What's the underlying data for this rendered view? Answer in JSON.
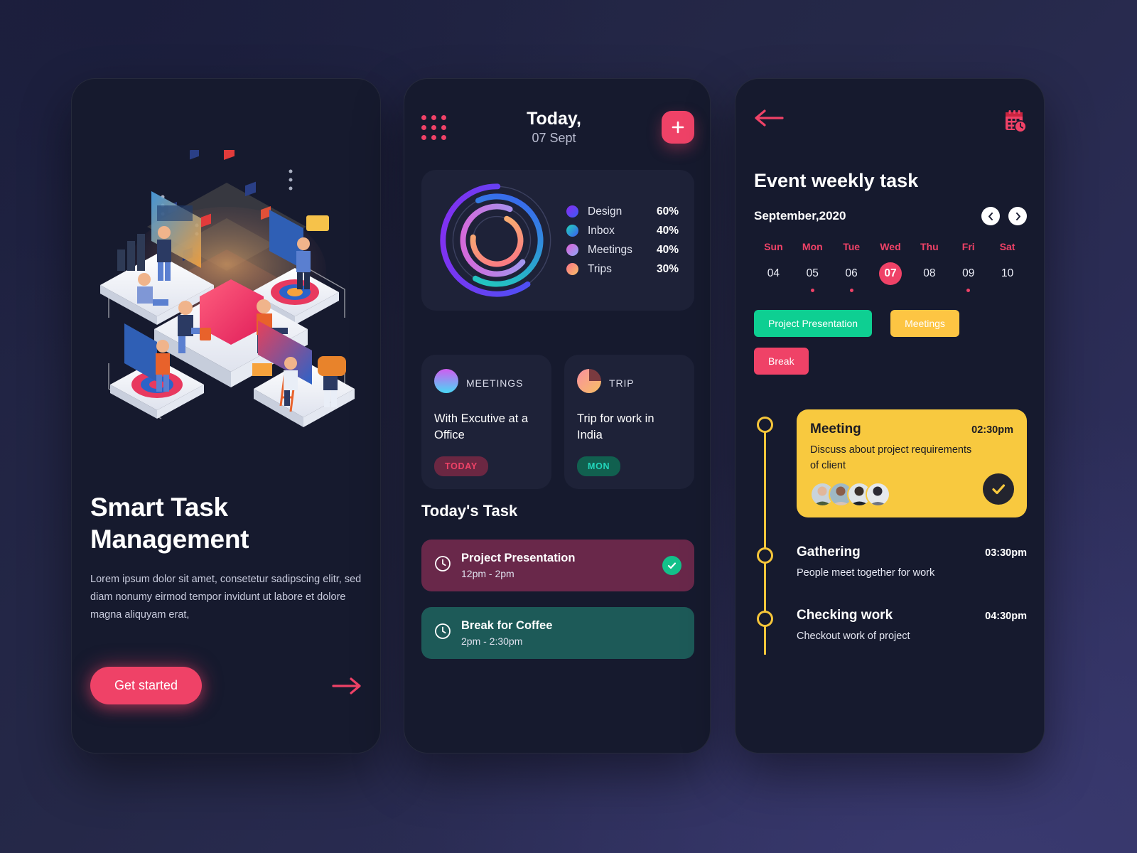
{
  "theme": {
    "accent_pink": "#ef4267",
    "accent_yellow": "#f8c93f",
    "accent_green": "#0ecf92",
    "panel_bg": "#161a2e",
    "card_bg": "#1e2238"
  },
  "onboarding": {
    "title": "Smart Task Management",
    "title_line1": "Smart Task",
    "title_line2": "Management",
    "description": "Lorem ipsum dolor sit amet, consetetur sadipscing elitr, sed diam nonumy eirmod tempor invidunt ut labore et dolore magna aliquyam erat,",
    "cta_label": "Get started",
    "next_icon": "arrow-right-icon",
    "illustration": "isometric-teamwork-illustration"
  },
  "today": {
    "menu_icon": "grid-dots-icon",
    "title": "Today,",
    "date": "07 Sept",
    "add_icon": "plus-icon",
    "chart_data": {
      "type": "pie",
      "title": "",
      "legend_position": "right",
      "categories": [
        "Design",
        "Inbox",
        "Meetings",
        "Trips"
      ],
      "values": [
        60,
        40,
        40,
        30
      ],
      "value_suffix": "%",
      "labels": [
        "60%",
        "40%",
        "40%",
        "30%"
      ],
      "colors": [
        "#7b2ff7",
        "#19d3c5",
        "#c77dff",
        "#fb8a6b"
      ],
      "ring_radii": [
        78,
        64,
        50,
        36
      ],
      "series": [
        {
          "name": "Design",
          "value": 60,
          "label": "60%",
          "color_start": "#8b2bf0",
          "color_end": "#3b5bf5",
          "ring": 0
        },
        {
          "name": "Inbox",
          "value": 40,
          "label": "40%",
          "color_start": "#1fd6b8",
          "color_end": "#3c5bf3",
          "ring": 1
        },
        {
          "name": "Meetings",
          "value": 40,
          "label": "40%",
          "color_start": "#e05fd6",
          "color_end": "#8ea8f7",
          "ring": 2
        },
        {
          "name": "Trips",
          "value": 30,
          "label": "30%",
          "color_start": "#fb7185",
          "color_end": "#f7c06a",
          "ring": 3
        }
      ]
    },
    "mini_cards": [
      {
        "kind": "MEETINGS",
        "icon": "gradient-circle-icon",
        "title": "With Excutive at a Office",
        "badge": "TODAY",
        "badge_style": "today"
      },
      {
        "kind": "TRIP",
        "icon": "pie-chart-icon",
        "title": "Trip for work in India",
        "badge": "MON",
        "badge_style": "mon"
      }
    ],
    "tasks_heading": "Today's Task",
    "tasks": [
      {
        "icon": "clock-icon",
        "title": "Project Presentation",
        "time": "12pm - 2pm",
        "style": "pink",
        "done": true
      },
      {
        "icon": "clock-icon",
        "title": "Break for Coffee",
        "time": "2pm - 2:30pm",
        "style": "teal",
        "done": false
      }
    ]
  },
  "event": {
    "back_icon": "arrow-left-icon",
    "calendar_icon": "calendar-clock-icon",
    "title": "Event weekly task",
    "month_label": "September,2020",
    "prev_icon": "chevron-left-icon",
    "next_icon": "chevron-right-icon",
    "days": [
      {
        "name": "Sun",
        "num": "04",
        "active": false,
        "dot": false
      },
      {
        "name": "Mon",
        "num": "05",
        "active": false,
        "dot": true
      },
      {
        "name": "Tue",
        "num": "06",
        "active": false,
        "dot": true
      },
      {
        "name": "Wed",
        "num": "07",
        "active": true,
        "dot": false
      },
      {
        "name": "Thu",
        "num": "08",
        "active": false,
        "dot": false
      },
      {
        "name": "Fri",
        "num": "09",
        "active": false,
        "dot": true
      },
      {
        "name": "Sat",
        "num": "10",
        "active": false,
        "dot": false
      }
    ],
    "tags": [
      {
        "label": "Project Presentation",
        "style": "green"
      },
      {
        "label": "Meetings",
        "style": "yellow"
      },
      {
        "label": "Break",
        "style": "pink"
      }
    ],
    "timeline": [
      {
        "name": "Meeting",
        "time": "02:30pm",
        "desc": "Discuss about project requirements of client",
        "highlighted": true,
        "done": true,
        "done_icon": "check-icon",
        "avatar_count": 4
      },
      {
        "name": "Gathering",
        "time": "03:30pm",
        "desc": "People meet together for work",
        "highlighted": false,
        "done": false
      },
      {
        "name": "Checking work",
        "time": "04:30pm",
        "desc": "Checkout work of project",
        "highlighted": false,
        "done": false
      }
    ]
  }
}
